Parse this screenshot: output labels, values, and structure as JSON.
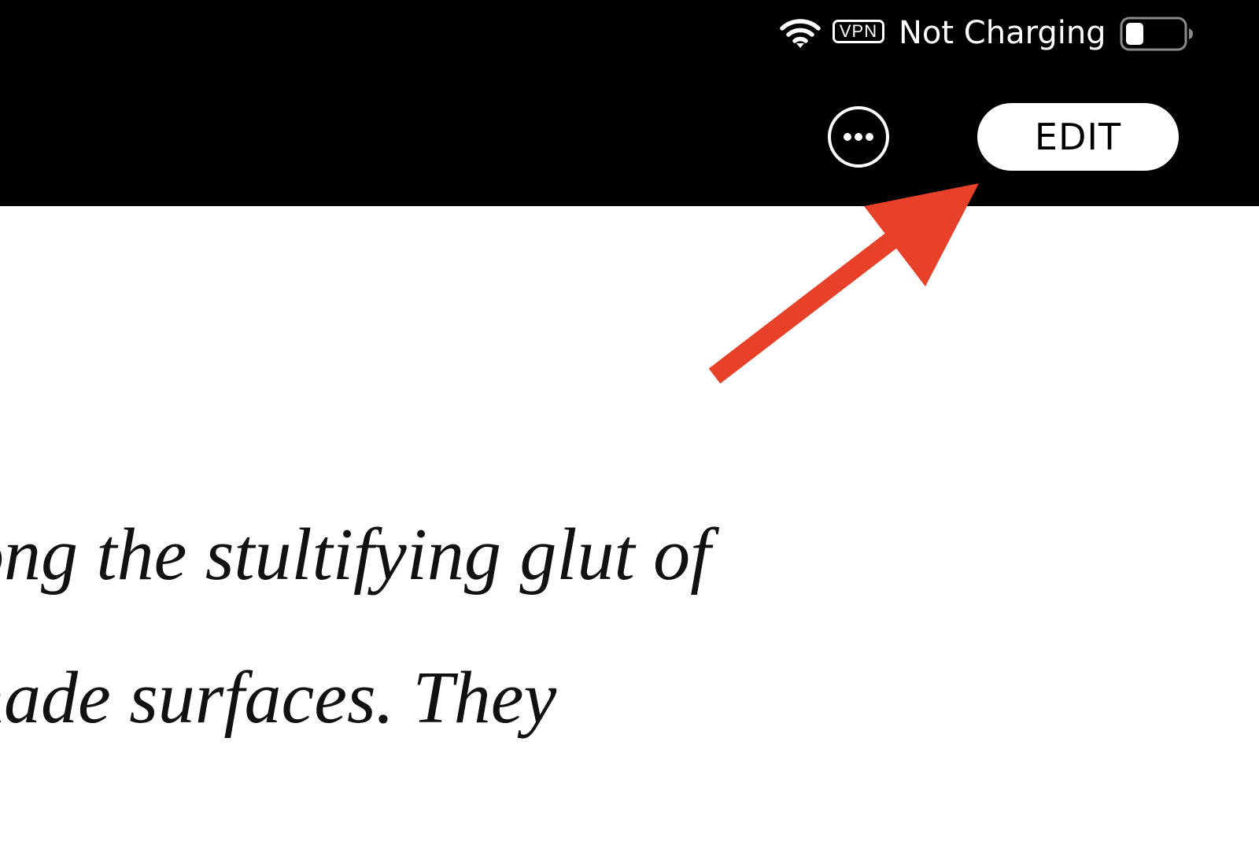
{
  "status_bar": {
    "wifi_icon": "wifi-icon",
    "vpn_label": "VPN",
    "charging_status": "Not Charging",
    "battery_icon": "battery-icon"
  },
  "toolbar": {
    "more_icon": "ellipsis-circle-icon",
    "edit_label": "EDIT"
  },
  "content": {
    "line_1": "ong the stultifying glut of",
    "line_2": "nade surfaces. They"
  },
  "annotation": {
    "arrow_color": "#E8412A"
  },
  "colors": {
    "bar_background": "#000000",
    "page_background": "#FFFFFF",
    "button_background": "#FFFFFF"
  }
}
